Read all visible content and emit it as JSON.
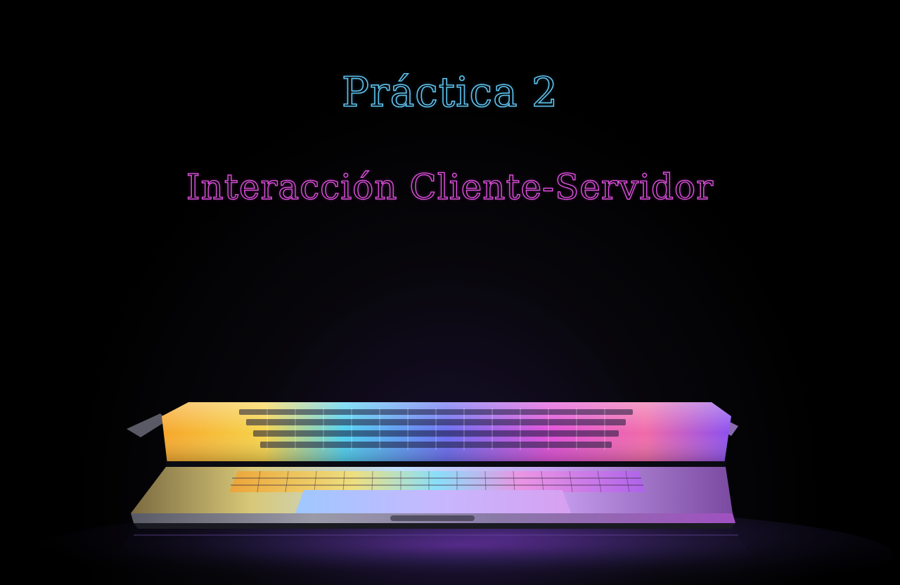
{
  "slide": {
    "title": "Práctica 2",
    "subtitle": "Interacción Cliente-Servidor"
  },
  "image": {
    "subject": "laptop-icon"
  },
  "colors": {
    "background": "#000000",
    "title_color": "#5fc4f0",
    "subtitle_color": "#e050e0"
  }
}
